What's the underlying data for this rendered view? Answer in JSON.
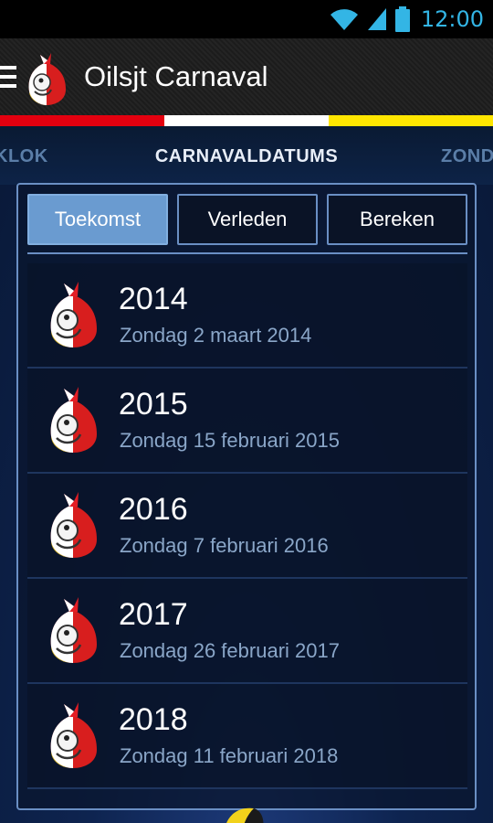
{
  "status_bar": {
    "time": "12:00",
    "icons": [
      "wifi-icon",
      "signal-icon",
      "battery-icon"
    ],
    "accent": "#33b5e5"
  },
  "action_bar": {
    "title": "Oilsjt Carnaval",
    "icons": [
      "menu-icon",
      "app-logo-icon"
    ]
  },
  "flag_colors": [
    "#e3000f",
    "#ffffff",
    "#ffe600"
  ],
  "tabs": {
    "left": "KLOK",
    "center": "CARNAVALDATUMS",
    "right": "ZOND"
  },
  "segments": [
    {
      "label": "Toekomst",
      "active": true
    },
    {
      "label": "Verleden",
      "active": false
    },
    {
      "label": "Bereken",
      "active": false
    }
  ],
  "items": [
    {
      "year": "2014",
      "date": "Zondag 2 maart 2014"
    },
    {
      "year": "2015",
      "date": "Zondag 15 februari 2015"
    },
    {
      "year": "2016",
      "date": "Zondag 7 februari 2016"
    },
    {
      "year": "2017",
      "date": "Zondag 26 februari 2017"
    },
    {
      "year": "2018",
      "date": "Zondag 11 februari 2018"
    }
  ]
}
